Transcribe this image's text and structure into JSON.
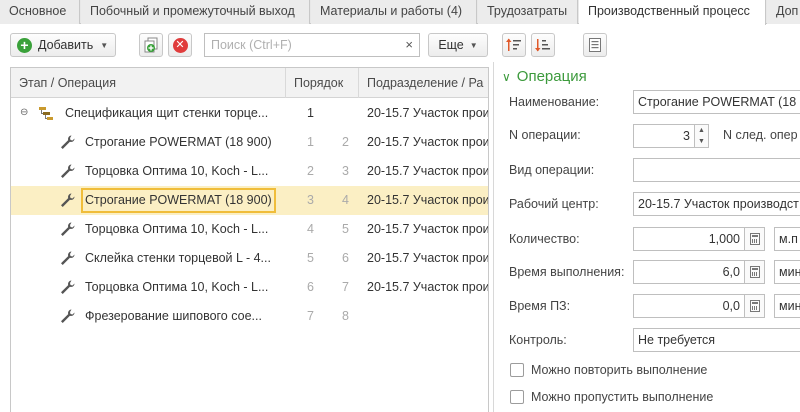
{
  "tabs": [
    {
      "label": "Основное"
    },
    {
      "label": "Побочный и промежуточный выход"
    },
    {
      "label": "Материалы и работы (4)"
    },
    {
      "label": "Трудозатраты"
    },
    {
      "label": "Производственный процесс"
    },
    {
      "label": "Доп"
    }
  ],
  "toolbar": {
    "add_label": "Добавить",
    "search_placeholder": "Поиск (Ctrl+F)",
    "clear_symbol": "×",
    "more_label": "Еще"
  },
  "grid": {
    "columns": [
      "Этап / Операция",
      "Порядок",
      "Подразделение / Ра"
    ],
    "rows": [
      {
        "name": "Спецификация щит стенки торце...",
        "ord1": "1",
        "ord2": "",
        "dept": "20-15.7 Участок прои",
        "icon": "stage-icon",
        "level": 0
      },
      {
        "name": "Строгание POWERMAT (18 900)",
        "ord1": "1",
        "ord2": "2",
        "dept": "20-15.7 Участок прои",
        "icon": "wrench-icon",
        "level": 1
      },
      {
        "name": "Торцовка Оптима 10, Koch - L...",
        "ord1": "2",
        "ord2": "3",
        "dept": "20-15.7 Участок прои",
        "icon": "wrench-icon",
        "level": 1
      },
      {
        "name": "Строгание POWERMAT (18 900)",
        "ord1": "3",
        "ord2": "4",
        "dept": "20-15.7 Участок прои",
        "icon": "wrench-icon",
        "level": 1,
        "selected": true
      },
      {
        "name": "Торцовка Оптима 10, Koch - L...",
        "ord1": "4",
        "ord2": "5",
        "dept": "20-15.7 Участок прои",
        "icon": "wrench-icon",
        "level": 1
      },
      {
        "name": "Склейка стенки торцевой L - 4...",
        "ord1": "5",
        "ord2": "6",
        "dept": "20-15.7 Участок прои",
        "icon": "wrench-icon",
        "level": 1
      },
      {
        "name": "Торцовка Оптима 10, Koch - L...",
        "ord1": "6",
        "ord2": "7",
        "dept": "20-15.7 Участок прои",
        "icon": "wrench-icon",
        "level": 1
      },
      {
        "name": "Фрезерование шипового сое...",
        "ord1": "7",
        "ord2": "8",
        "dept": "",
        "icon": "wrench-icon",
        "level": 1
      }
    ]
  },
  "form": {
    "group_title": "Операция",
    "name_label": "Наименование:",
    "name_value": "Строгание POWERMAT (18",
    "opnum_label": "N операции:",
    "opnum_value": "3",
    "next_op_label": "N след. опер",
    "optype_label": "Вид операции:",
    "optype_value": "",
    "workcenter_label": "Рабочий центр:",
    "workcenter_value": "20-15.7 Участок производст",
    "qty_label": "Количество:",
    "qty_value": "1,000",
    "qty_unit": "м.п",
    "time_label": "Время выполнения:",
    "time_value": "6,0",
    "time_unit": "мин",
    "pz_label": "Время ПЗ:",
    "pz_value": "0,0",
    "pz_unit": "мин",
    "control_label": "Контроль:",
    "control_value": "Не требуется",
    "repeat_label": "Можно повторить выполнение",
    "skip_label": "Можно пропустить выполнение"
  },
  "colors": {
    "accent_green": "#3c9a3c",
    "selection": "#fbefc4",
    "selection_border": "#f0bd3a"
  }
}
